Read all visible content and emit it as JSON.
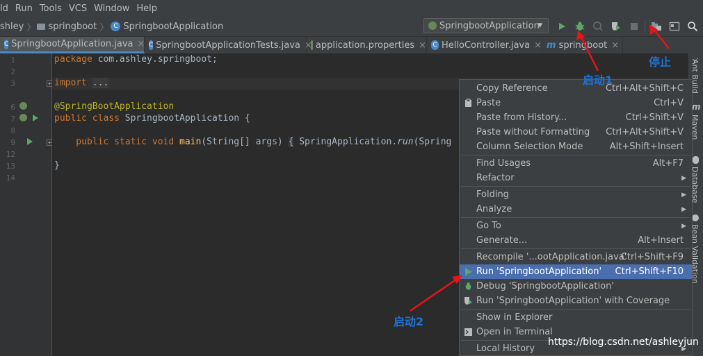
{
  "menubar": [
    "ld",
    "Run",
    "Tools",
    "VCS",
    "Window",
    "Help"
  ],
  "breadcrumb": [
    "shley",
    "springboot",
    "SpringbootApplication"
  ],
  "run_config": "SpringbootApplication",
  "tabs": [
    {
      "label": "SpringbootApplication.java",
      "icon_color": "#4a88c7",
      "letter": "C"
    },
    {
      "label": "SpringbootApplicationTests.java",
      "icon_color": "#4a88c7",
      "letter": "C"
    },
    {
      "label": "application.properties",
      "icon_color": "#6a8759",
      "letter": ""
    },
    {
      "label": "HelloController.java",
      "icon_color": "#4a88c7",
      "letter": "C"
    },
    {
      "label": "springboot",
      "icon_color": "#4a88c7",
      "letter": "m"
    }
  ],
  "line_numbers": [
    "1",
    "2",
    "3",
    "6",
    "7",
    "8",
    "9",
    "12",
    "13",
    "14"
  ],
  "code": {
    "l1_kw": "package",
    "l1_rest": " com.ashley.springboot;",
    "l3_kw": "import",
    "l3_fold": "...",
    "l6": "@SpringBootApplication",
    "l7_kw": "public class",
    "l7_rest": " SpringbootApplication {",
    "l9_kw": "    public static void",
    "l9_fn": " main",
    "l9_args": "(String[] args)",
    "l9_fold": "{",
    "l9_call": " SpringApplication.",
    "l9_run": "run",
    "l9_tail": "(Spring",
    "l13": "}"
  },
  "context_menu": [
    {
      "label": "Copy Reference",
      "shortcut": "Ctrl+Alt+Shift+C"
    },
    {
      "label": "Paste",
      "shortcut": "Ctrl+V",
      "icon": "clipboard-icon"
    },
    {
      "label": "Paste from History...",
      "shortcut": "Ctrl+Shift+V"
    },
    {
      "label": "Paste without Formatting",
      "shortcut": "Ctrl+Alt+Shift+V"
    },
    {
      "label": "Column Selection Mode",
      "shortcut": "Alt+Shift+Insert"
    },
    {
      "label": "Find Usages",
      "shortcut": "Alt+F7"
    },
    {
      "label": "Refactor",
      "submenu": true
    },
    {
      "label": "Folding",
      "submenu": true
    },
    {
      "label": "Analyze",
      "submenu": true
    },
    {
      "label": "Go To",
      "submenu": true
    },
    {
      "label": "Generate...",
      "shortcut": "Alt+Insert"
    },
    {
      "label": "Recompile '...ootApplication.java'",
      "shortcut": "Ctrl+Shift+F9"
    },
    {
      "label": "Run 'SpringbootApplication'",
      "shortcut": "Ctrl+Shift+F10",
      "icon": "run-icon",
      "selected": true
    },
    {
      "label": "Debug 'SpringbootApplication'",
      "icon": "debug-icon"
    },
    {
      "label": "Run 'SpringbootApplication' with Coverage",
      "icon": "coverage-icon"
    },
    {
      "label": "Show in Explorer"
    },
    {
      "label": "Open in Terminal",
      "icon": "terminal-icon"
    },
    {
      "label": "Local History",
      "submenu": true
    }
  ],
  "right_strip": [
    "Ant Build",
    "Maven",
    "Database",
    "Bean Validation"
  ],
  "annotations": {
    "stop": "停止",
    "start1": "启动1",
    "start2": "启动2"
  },
  "watermark": "https://blog.csdn.net/ashleyjun",
  "colors": {
    "accent": "#4a88c7",
    "run_green": "#59a869",
    "arrow_red": "#e8141a",
    "annotation_blue": "#1e73d8"
  }
}
